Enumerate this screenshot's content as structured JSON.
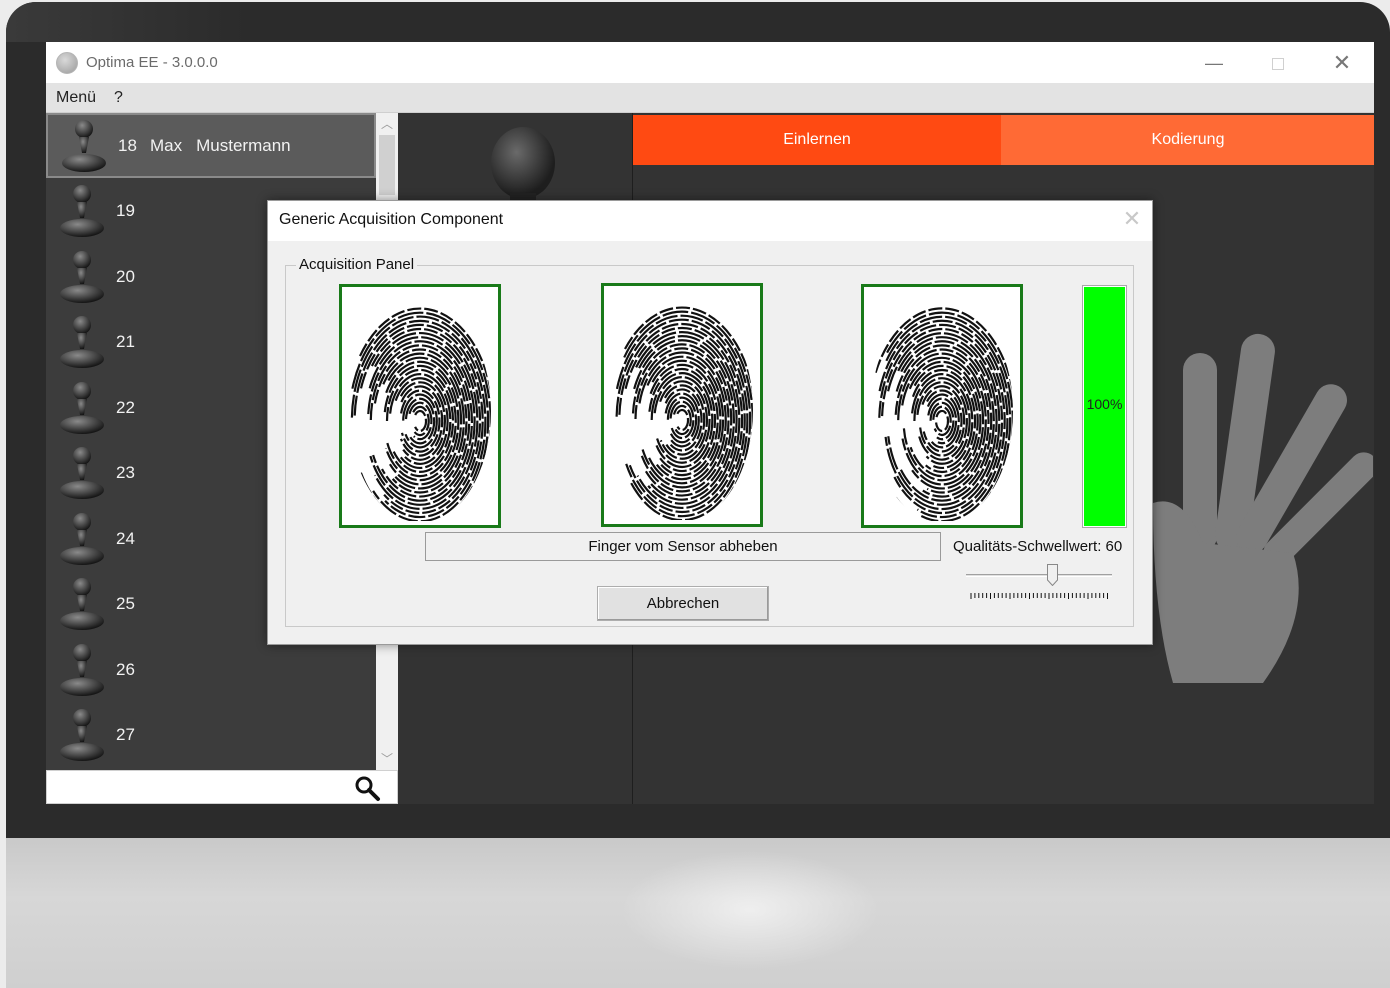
{
  "window": {
    "title": "Optima EE - 3.0.0.0",
    "controls": {
      "minimize": "—",
      "close": "✕"
    }
  },
  "menubar": {
    "items": [
      "Menü",
      "?"
    ]
  },
  "person_list": {
    "rows": [
      {
        "id": "18",
        "first_name": "Max",
        "last_name": "Mustermann",
        "selected": true
      },
      {
        "id": "19",
        "first_name": "",
        "last_name": "",
        "selected": false
      },
      {
        "id": "20",
        "first_name": "",
        "last_name": "",
        "selected": false
      },
      {
        "id": "21",
        "first_name": "",
        "last_name": "",
        "selected": false
      },
      {
        "id": "22",
        "first_name": "",
        "last_name": "",
        "selected": false
      },
      {
        "id": "23",
        "first_name": "",
        "last_name": "",
        "selected": false
      },
      {
        "id": "24",
        "first_name": "",
        "last_name": "",
        "selected": false
      },
      {
        "id": "25",
        "first_name": "",
        "last_name": "",
        "selected": false
      },
      {
        "id": "26",
        "first_name": "",
        "last_name": "",
        "selected": false
      },
      {
        "id": "27",
        "first_name": "",
        "last_name": "",
        "selected": false
      }
    ],
    "search": {
      "value": "",
      "icon": "search-icon"
    }
  },
  "tabs": [
    {
      "label": "Einlernen",
      "color": "#ff4a12"
    },
    {
      "label": "Kodierung",
      "color": "#ff6a35"
    }
  ],
  "dialog": {
    "title": "Generic Acquisition Component",
    "group_label": "Acquisition Panel",
    "fingerprint_count": 3,
    "quality": {
      "label": "100%",
      "fraction": 1.0,
      "color": "#00ff00"
    },
    "status_text": "Finger vom Sensor abheben",
    "threshold_label": "Qualitäts-Schwellwert: 60",
    "threshold_value": 60,
    "cancel_label": "Abbrechen"
  },
  "colors": {
    "accent": "#ff4a12",
    "fingerprint_frame": "#197a19",
    "background_dark": "#333333"
  }
}
